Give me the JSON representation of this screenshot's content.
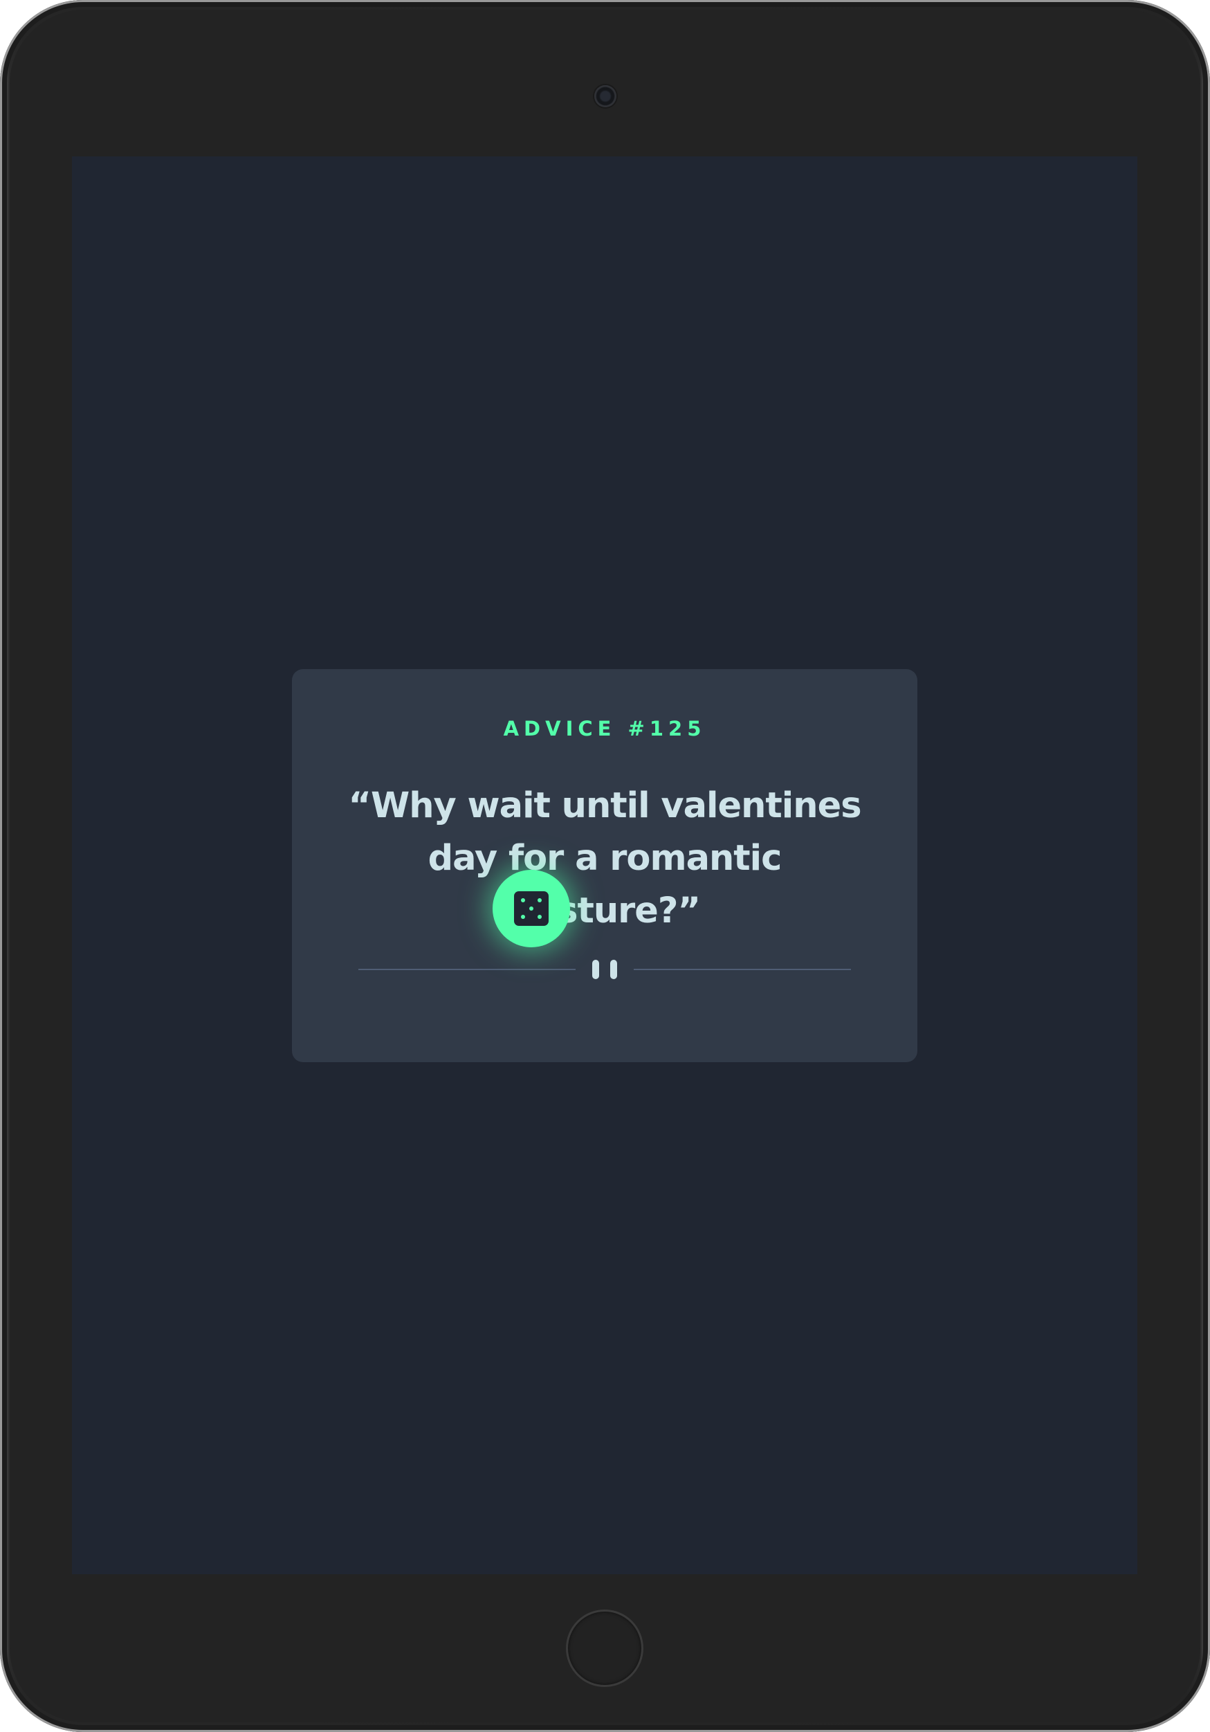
{
  "advice": {
    "id_label": "ADVICE #125",
    "quote": "“Why wait until valentines day for a romantic gesture?”"
  },
  "divider": {
    "icon": "pause-icon"
  },
  "dice_button": {
    "icon": "dice-icon"
  },
  "colors": {
    "background": "#202632",
    "card": "#313a48",
    "accent": "#53ffaa",
    "text": "#cee3e9",
    "divider": "#4f5d74"
  }
}
